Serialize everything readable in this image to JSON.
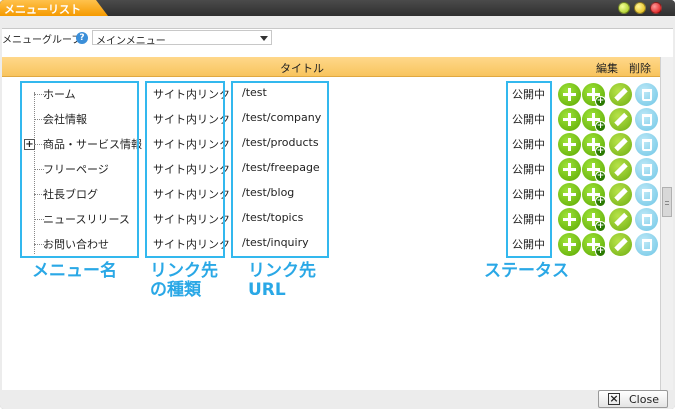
{
  "window": {
    "title": "メニューリスト"
  },
  "group": {
    "label": "メニューグループ",
    "selected": "メインメニュー"
  },
  "table": {
    "header_title": "タイトル",
    "header_edit": "編集",
    "header_delete": "削除",
    "rows": [
      {
        "name": "ホーム",
        "link_type": "サイト内リンク",
        "url": "/test",
        "status": "公開中",
        "expandable": false
      },
      {
        "name": "会社情報",
        "link_type": "サイト内リンク",
        "url": "/test/company",
        "status": "公開中",
        "expandable": false
      },
      {
        "name": "商品・サービス情報",
        "link_type": "サイト内リンク",
        "url": "/test/products",
        "status": "公開中",
        "expandable": true
      },
      {
        "name": "フリーページ",
        "link_type": "サイト内リンク",
        "url": "/test/freepage",
        "status": "公開中",
        "expandable": false
      },
      {
        "name": "社長ブログ",
        "link_type": "サイト内リンク",
        "url": "/test/blog",
        "status": "公開中",
        "expandable": false
      },
      {
        "name": "ニュースリリース",
        "link_type": "サイト内リンク",
        "url": "/test/topics",
        "status": "公開中",
        "expandable": false
      },
      {
        "name": "お問い合わせ",
        "link_type": "サイト内リンク",
        "url": "/test/inquiry",
        "status": "公開中",
        "expandable": false
      }
    ]
  },
  "annotations": {
    "menu_name": "メニュー名",
    "link_type_line1": "リンク先",
    "link_type_line2": "の種類",
    "url_line1": "リンク先",
    "url_line2": "URL",
    "status": "ステータス"
  },
  "footer": {
    "close_label": "Close"
  },
  "colors": {
    "accent_orange": "#f59a00",
    "header_yellow": "#f8c45e",
    "annotation_blue": "#2aa8e6",
    "action_green": "#5aa800",
    "delete_blue": "#6fc6e6"
  }
}
